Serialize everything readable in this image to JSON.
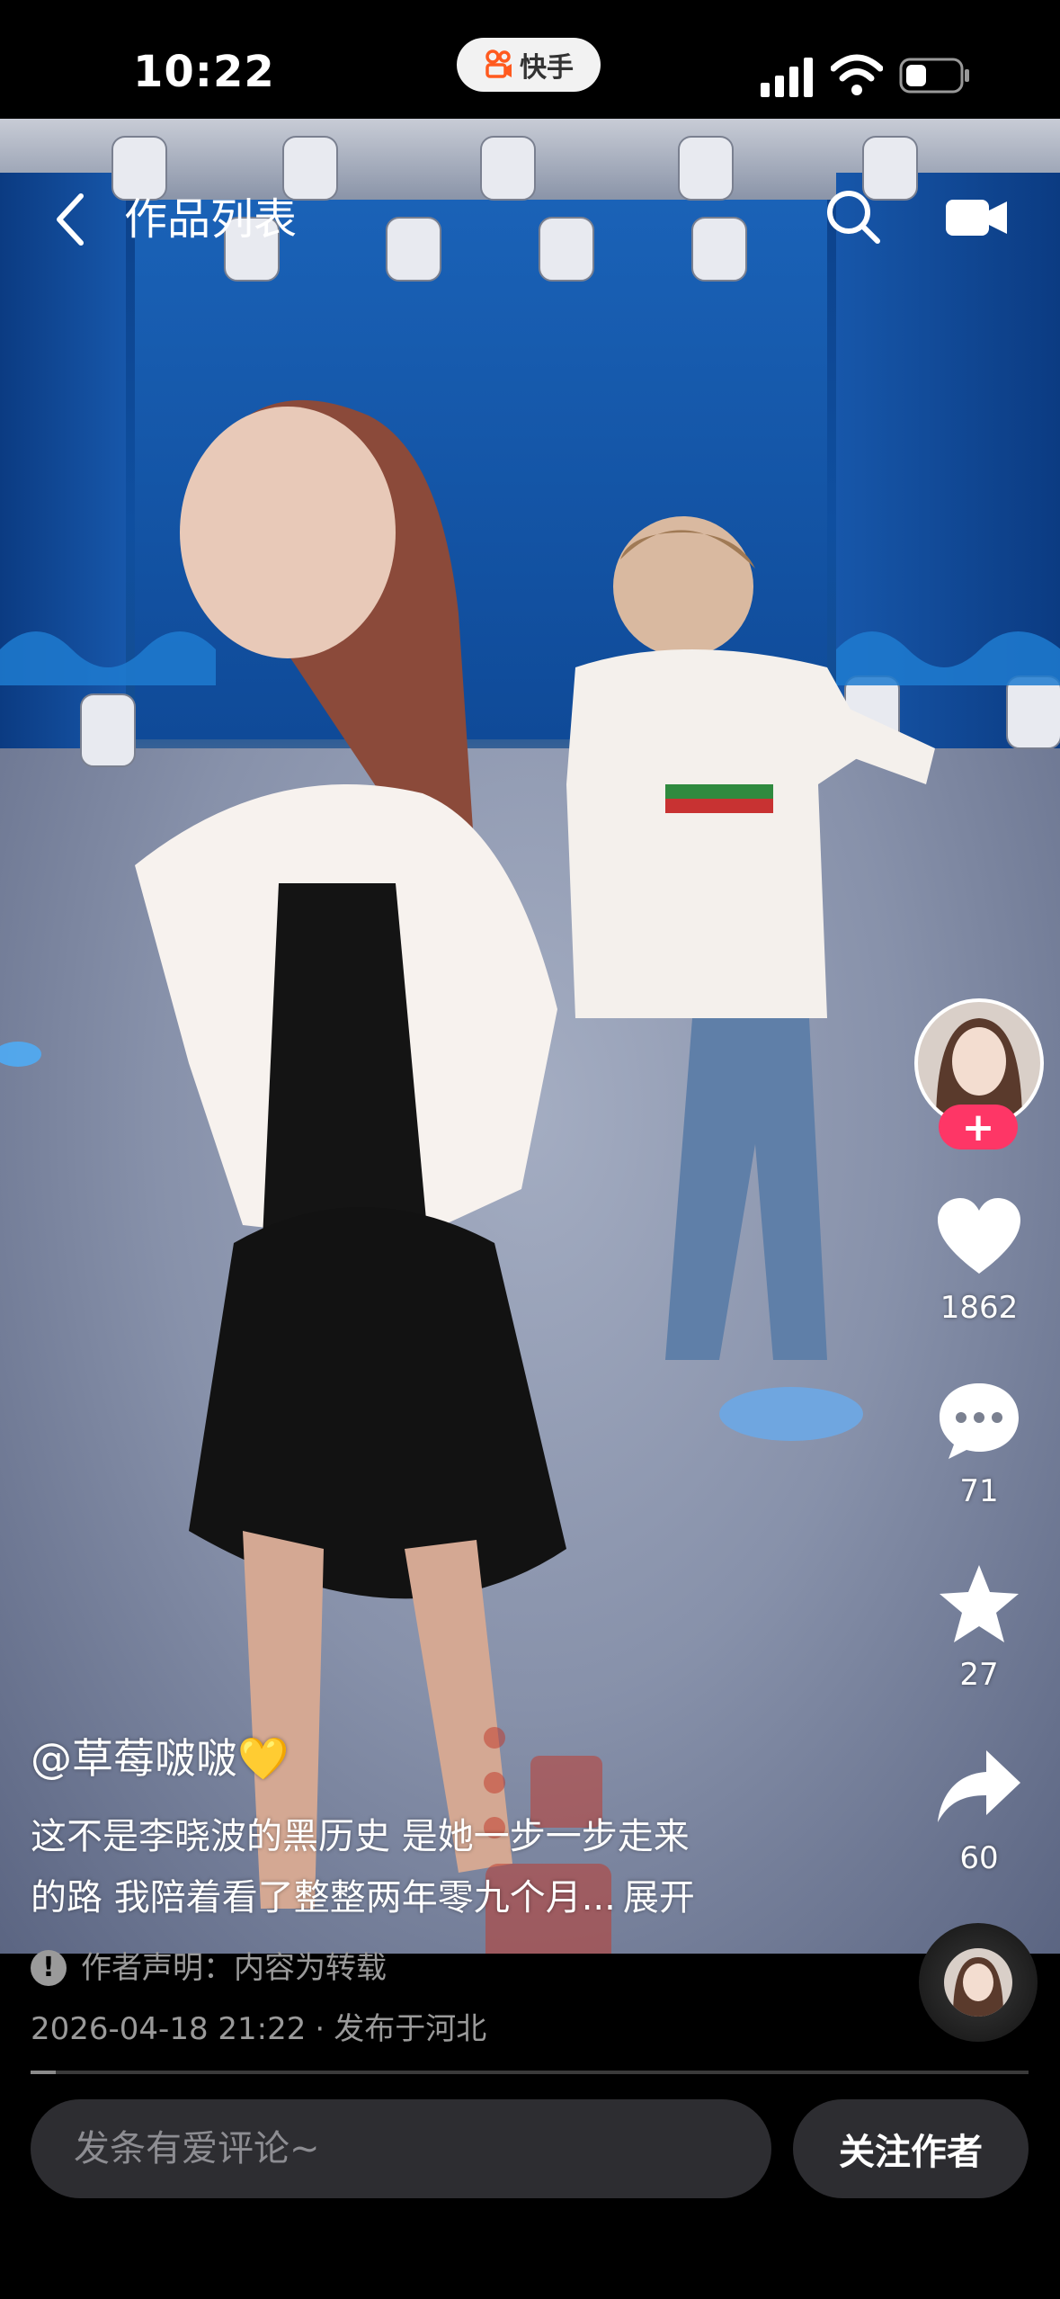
{
  "status_bar": {
    "time": "10:22",
    "app_pill_label": "快手"
  },
  "nav": {
    "title": "作品列表"
  },
  "actions": {
    "like_count": "1862",
    "comment_count": "71",
    "favorite_count": "27",
    "share_count": "60",
    "follow_plus": "+"
  },
  "post": {
    "author": "@草莓啵啵💛",
    "description_line1": "这不是李晓波的黑历史 是她一步一步走来",
    "description_line2": "的路 我陪着看了整整两年零九个月...",
    "expand_label": "展开",
    "notice": "作者声明：内容为转载",
    "notice_icon": "!",
    "datetime": "2026-04-18 21:22",
    "separator": "·",
    "location": "发布于河北",
    "progress": 0.025
  },
  "bottom_bar": {
    "comment_placeholder": "发条有爱评论~",
    "follow_label": "关注作者"
  },
  "colors": {
    "accent": "#fe3666",
    "muted_text": "#9a9a9a",
    "bar_bg": "#2d2d31"
  },
  "icons": [
    "back-icon",
    "search-icon",
    "camera-icon",
    "heart-icon",
    "comment-icon",
    "star-icon",
    "share-icon",
    "alert-icon",
    "kuaishou-logo-icon"
  ]
}
